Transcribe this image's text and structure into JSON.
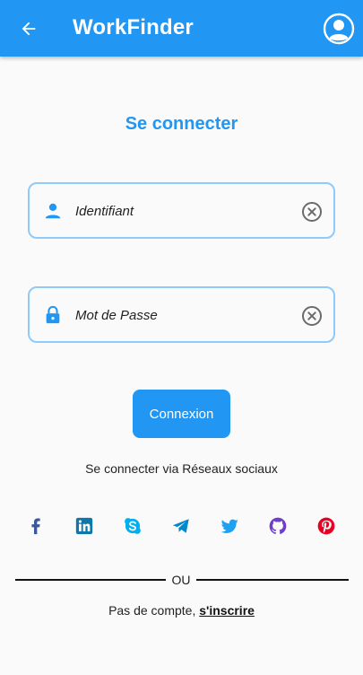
{
  "app_bar": {
    "title": "WorkFinder",
    "back_icon": "arrow-left-icon",
    "profile_icon": "account-circle-icon"
  },
  "login": {
    "title": "Se connecter",
    "username": {
      "placeholder": "Identifiant",
      "value": "",
      "icon": "person-icon",
      "clear_icon": "clear-circle-icon"
    },
    "password": {
      "placeholder": "Mot de Passe",
      "value": "",
      "icon": "lock-icon",
      "clear_icon": "clear-circle-icon"
    },
    "submit_label": "Connexion"
  },
  "social": {
    "caption": "Se connecter via Réseaux sociaux",
    "items": [
      {
        "icon": "facebook-icon",
        "color": "#3b5998"
      },
      {
        "icon": "linkedin-icon",
        "color": "#0e76a8"
      },
      {
        "icon": "skype-icon",
        "color": "#00aff0"
      },
      {
        "icon": "telegram-icon",
        "color": "#0088cc"
      },
      {
        "icon": "twitter-icon",
        "color": "#1da1f2"
      },
      {
        "icon": "github-icon",
        "color": "#6e40c9"
      },
      {
        "icon": "pinterest-icon",
        "color": "#e60023"
      }
    ]
  },
  "divider_text": "OU",
  "signup": {
    "prompt": "Pas de compte, ",
    "link_label": "s'inscrire"
  },
  "colors": {
    "primary": "#2196f3",
    "field_border": "#90caf9",
    "background": "#fafafa"
  }
}
